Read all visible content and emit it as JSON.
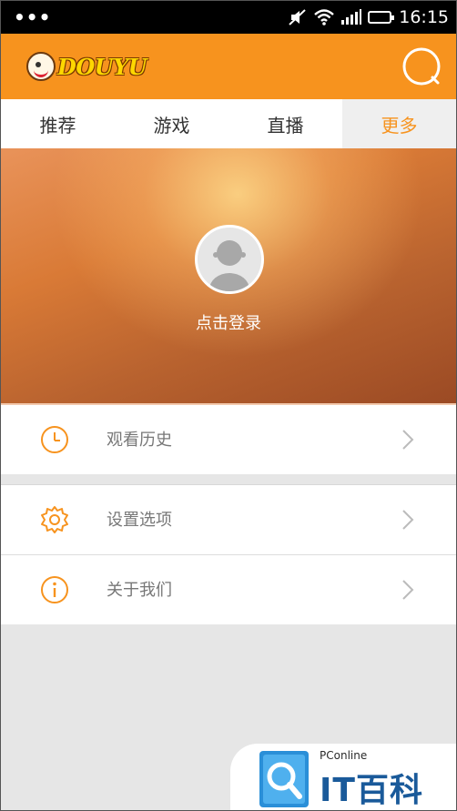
{
  "status_bar": {
    "dots": "•••",
    "time": "16:15",
    "icons": [
      "mute-icon",
      "wifi-icon",
      "signal-icon",
      "battery-icon"
    ]
  },
  "app_bar": {
    "logo_text": "DOUYU",
    "search_icon": "search-icon",
    "accent_color": "#f7931e"
  },
  "tabs": [
    {
      "label": "推荐"
    },
    {
      "label": "游戏"
    },
    {
      "label": "直播"
    },
    {
      "label": "更多",
      "active": true
    }
  ],
  "profile": {
    "login_label": "点击登录",
    "avatar_icon": "default-avatar-icon"
  },
  "menu": [
    {
      "label": "观看历史",
      "icon": "clock-icon"
    },
    {
      "label": "设置选项",
      "icon": "gear-icon"
    },
    {
      "label": "关于我们",
      "icon": "info-icon"
    }
  ],
  "watermark": {
    "small": "PConline",
    "big": "IT百科"
  }
}
